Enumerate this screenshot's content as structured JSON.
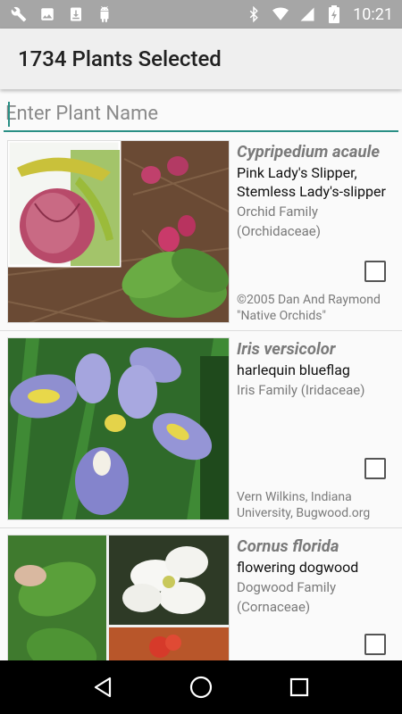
{
  "status_bar": {
    "time": "10:21",
    "left_icons": [
      "wrench-icon",
      "image-icon",
      "download-icon",
      "android-icon"
    ],
    "right_icons": [
      "bluetooth-icon",
      "wifi-icon",
      "signal-icon",
      "battery-icon"
    ]
  },
  "app_bar": {
    "title": "1734 Plants Selected"
  },
  "search": {
    "placeholder": "Enter Plant Name",
    "value": ""
  },
  "colors": {
    "accent": "#2a8f85",
    "status_bar": "#a6a6a6",
    "app_bar": "#efefef"
  },
  "plants": [
    {
      "scientific_name": "Cypripedium acaule",
      "common_name": "Pink Lady's Slipper, Stemless Lady's-slipper",
      "family": "Orchid Family (Orchidaceae)",
      "credit": "©2005 Dan And Raymond \"Native Orchids\"",
      "selected": false
    },
    {
      "scientific_name": "Iris versicolor",
      "common_name": "harlequin blueflag",
      "family": "Iris Family (Iridaceae)",
      "credit": "Vern Wilkins, Indiana University, Bugwood.org",
      "selected": false
    },
    {
      "scientific_name": "Cornus florida",
      "common_name": "flowering dogwood",
      "family": "Dogwood Family (Cornaceae)",
      "credit": "",
      "selected": false
    }
  ],
  "nav": {
    "icons": [
      "back-icon",
      "home-icon",
      "recents-icon"
    ]
  }
}
